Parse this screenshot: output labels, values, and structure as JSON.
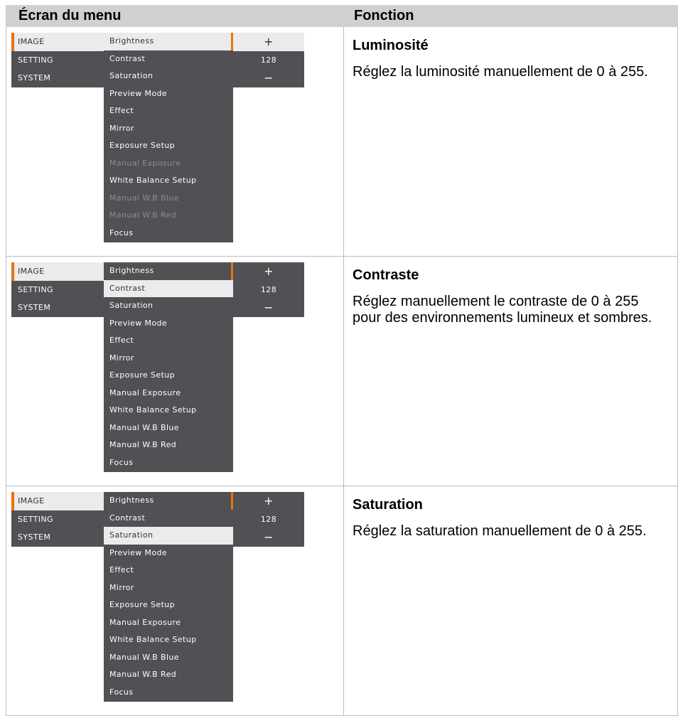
{
  "header": {
    "left": "Écran du menu",
    "right": "Fonction"
  },
  "rows": [
    {
      "title": "Luminosité",
      "desc": "Réglez la luminosité manuellement de 0 à 255.",
      "menu": {
        "categories": [
          "IMAGE",
          "SETTING",
          "SYSTEM"
        ],
        "items": [
          "Brightness",
          "Contrast",
          "Saturation",
          "Preview Mode",
          "Effect",
          "Mirror",
          "Exposure Setup",
          "Manual Exposure",
          "White Balance Setup",
          "Manual W.B Blue",
          "Manual W.B Red",
          "Focus"
        ],
        "plus": "+",
        "value": "128",
        "minus": "−"
      }
    },
    {
      "title": "Contraste",
      "desc": "Réglez manuellement le contraste de 0 à 255 pour des environnements lumineux et sombres.",
      "menu": {
        "categories": [
          "IMAGE",
          "SETTING",
          "SYSTEM"
        ],
        "items": [
          "Brightness",
          "Contrast",
          "Saturation",
          "Preview Mode",
          "Effect",
          "Mirror",
          "Exposure Setup",
          "Manual Exposure",
          "White Balance Setup",
          "Manual W.B Blue",
          "Manual W.B Red",
          "Focus"
        ],
        "plus": "+",
        "value": "128",
        "minus": "−"
      }
    },
    {
      "title": "Saturation",
      "desc": "Réglez la saturation manuellement de 0 à 255.",
      "menu": {
        "categories": [
          "IMAGE",
          "SETTING",
          "SYSTEM"
        ],
        "items": [
          "Brightness",
          "Contrast",
          "Saturation",
          "Preview Mode",
          "Effect",
          "Mirror",
          "Exposure Setup",
          "Manual Exposure",
          "White Balance Setup",
          "Manual W.B Blue",
          "Manual W.B Red",
          "Focus"
        ],
        "plus": "+",
        "value": "128",
        "minus": "−"
      }
    }
  ],
  "colors": {
    "menu_bg": "#505055",
    "highlight": "#ebebeb",
    "accent": "#e8720c",
    "dim_text": "#8b8b90",
    "header_bg": "#d0d0d0"
  }
}
